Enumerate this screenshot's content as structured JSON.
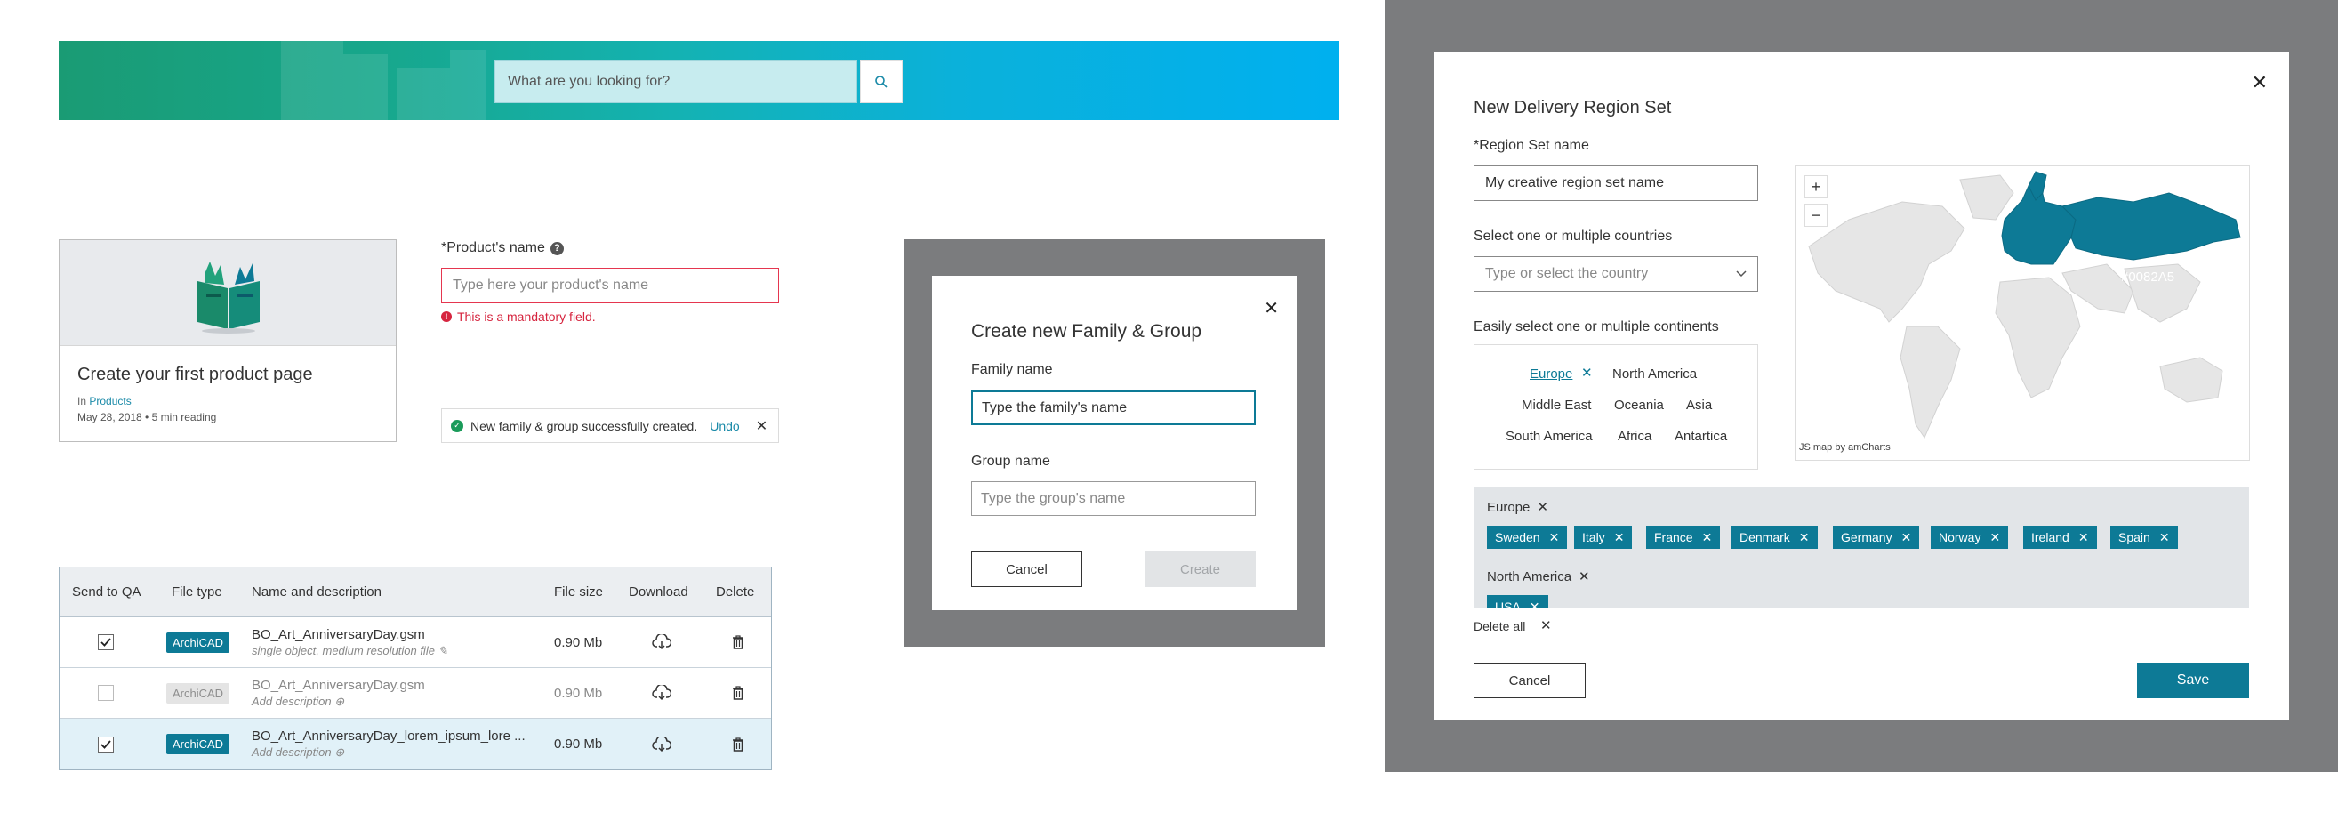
{
  "search": {
    "placeholder": "What are you looking for?"
  },
  "card": {
    "title": "Create your first product page",
    "category_prefix": "In",
    "category": "Products",
    "meta": "May 28, 2018 • 5 min reading"
  },
  "product_name": {
    "label": "*Product's name",
    "placeholder": "Type here your product's name",
    "error": "This is a mandatory field."
  },
  "toast": {
    "message": "New family & group successfully created.",
    "undo": "Undo"
  },
  "file_table": {
    "headers": [
      "Send to QA",
      "File type",
      "Name and description",
      "File size",
      "Download",
      "Delete"
    ],
    "rows": [
      {
        "checked": true,
        "type": "ArchiCAD",
        "name": "BO_Art_AnniversaryDay.gsm",
        "desc": "single object, medium resolution file",
        "size": "0.90 Mb",
        "state": "active"
      },
      {
        "checked": false,
        "type": "ArchiCAD",
        "name": "BO_Art_AnniversaryDay.gsm",
        "desc": "Add description",
        "size": "0.90 Mb",
        "state": "disabled"
      },
      {
        "checked": true,
        "type": "ArchiCAD",
        "name": "BO_Art_AnniversaryDay_lorem_ipsum_lore ...",
        "desc": "Add description",
        "size": "0.90 Mb",
        "state": "selected"
      }
    ]
  },
  "family_modal": {
    "title": "Create new Family & Group",
    "family_label": "Family name",
    "family_placeholder": "Type the family's name",
    "group_label": "Group name",
    "group_placeholder": "Type the group's name",
    "cancel": "Cancel",
    "create": "Create"
  },
  "region_modal": {
    "title": "New Delivery Region Set",
    "name_label": "*Region Set name",
    "name_value": "My creative region set name",
    "countries_label": "Select one or multiple countries",
    "countries_placeholder": "Type or select the country",
    "continents_label": "Easily select one or multiple continents",
    "continents": [
      "Europe",
      "North America",
      "Middle East",
      "Oceania",
      "Asia",
      "South America",
      "Africa",
      "Antartica"
    ],
    "selected_continent": "Europe",
    "map_credit": "JS map by amCharts",
    "map_highlight_color": "#0082A5",
    "groups": [
      {
        "name": "Europe",
        "countries": [
          "Sweden",
          "Italy",
          "France",
          "Denmark",
          "Germany",
          "Norway",
          "Ireland",
          "Spain"
        ]
      },
      {
        "name": "North America",
        "countries": [
          "USA"
        ]
      }
    ],
    "delete_all": "Delete all",
    "cancel": "Cancel",
    "save": "Save"
  },
  "colors": {
    "primary": "#0d7a96",
    "error": "#d6253f",
    "success": "#1a9b5a",
    "overlay": "#7b7c7e"
  }
}
